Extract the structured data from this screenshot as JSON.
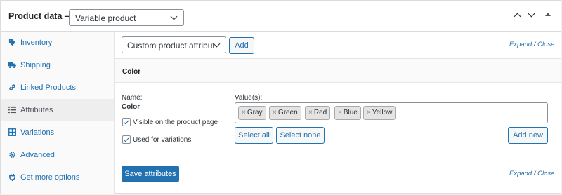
{
  "header": {
    "title": "Product data —",
    "product_type": "Variable product"
  },
  "sidebar": {
    "items": [
      {
        "label": "Inventory",
        "icon": "tag-icon"
      },
      {
        "label": "Shipping",
        "icon": "truck-icon"
      },
      {
        "label": "Linked Products",
        "icon": "link-icon"
      },
      {
        "label": "Attributes",
        "icon": "list-icon"
      },
      {
        "label": "Variations",
        "icon": "grid-icon"
      },
      {
        "label": "Advanced",
        "icon": "gear-icon"
      },
      {
        "label": "Get more options",
        "icon": "plugin-icon"
      }
    ],
    "active": "Attributes"
  },
  "toolbar": {
    "attribute_select": "Custom product attribute",
    "add_label": "Add",
    "expand": "Expand",
    "separator": " / ",
    "close": "Close"
  },
  "attribute": {
    "heading": "Color",
    "name_label": "Name:",
    "name_value": "Color",
    "values_label": "Value(s):",
    "values": [
      "Gray",
      "Green",
      "Red",
      "Blue",
      "Yellow"
    ],
    "remove_glyph": "×",
    "visible_label": "Visible on the product page",
    "visible_checked": true,
    "variations_label": "Used for variations",
    "variations_checked": true,
    "select_all": "Select all",
    "select_none": "Select none",
    "add_new": "Add new"
  },
  "footer": {
    "save_label": "Save attributes",
    "expand": "Expand",
    "separator": " / ",
    "close": "Close"
  },
  "colors": {
    "accent": "#2271b1",
    "border": "#dcdcde",
    "sidebar_bg": "#fafafa",
    "sidebar_active_bg": "#eeeeee"
  }
}
